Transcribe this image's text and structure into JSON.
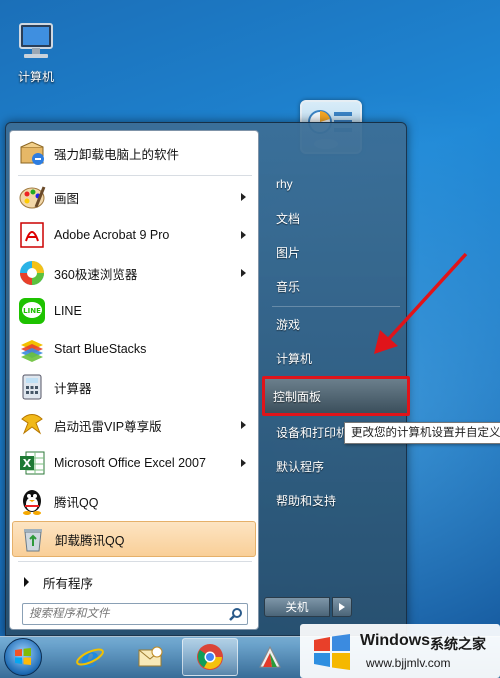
{
  "desktop": {
    "computer_icon_label": "计算机"
  },
  "start_menu": {
    "programs": [
      {
        "label": "强力卸载电脑上的软件",
        "icon": "uninstall-box-icon",
        "has_submenu": false
      },
      {
        "label": "画图",
        "icon": "paint-palette-icon",
        "has_submenu": true
      },
      {
        "label": "Adobe Acrobat 9 Pro",
        "icon": "adobe-acrobat-icon",
        "has_submenu": true
      },
      {
        "label": "360极速浏览器",
        "icon": "360-browser-icon",
        "has_submenu": true
      },
      {
        "label": "LINE",
        "icon": "line-app-icon",
        "has_submenu": false
      },
      {
        "label": "Start BlueStacks",
        "icon": "bluestacks-icon",
        "has_submenu": false
      },
      {
        "label": "计算器",
        "icon": "calculator-icon",
        "has_submenu": false
      },
      {
        "label": "启动迅雷VIP尊享版",
        "icon": "xunlei-icon",
        "has_submenu": true
      },
      {
        "label": "Microsoft Office Excel 2007",
        "icon": "excel-icon",
        "has_submenu": true
      },
      {
        "label": "腾讯QQ",
        "icon": "qq-penguin-icon",
        "has_submenu": false
      },
      {
        "label": "卸载腾讯QQ",
        "icon": "recycle-bin-icon",
        "has_submenu": false,
        "selected": true
      }
    ],
    "all_programs_label": "所有程序",
    "search_placeholder": "搜索程序和文件",
    "right_items": [
      {
        "label": "rhy"
      },
      {
        "label": "文档"
      },
      {
        "label": "图片"
      },
      {
        "label": "音乐"
      },
      {
        "label": "游戏"
      },
      {
        "label": "计算机"
      },
      {
        "label": "控制面板",
        "highlighted": true
      },
      {
        "label": "设备和打印机"
      },
      {
        "label": "默认程序"
      },
      {
        "label": "帮助和支持"
      }
    ],
    "shutdown_label": "关机",
    "tooltip_text": "更改您的计算机设置并自定义"
  },
  "taskbar": {
    "items": [
      "windows-start-orb-icon",
      "internet-explorer-icon",
      "mail-icon",
      "chrome-icon",
      "photo-app-icon"
    ]
  },
  "watermark": {
    "title": "Windows",
    "subtitle": "系统之家",
    "url": "www.bjjmlv.com"
  },
  "colors": {
    "highlight_border": "#e0141a",
    "selected_item_bg": "#f9cf98",
    "arrow": "#e0141a"
  }
}
